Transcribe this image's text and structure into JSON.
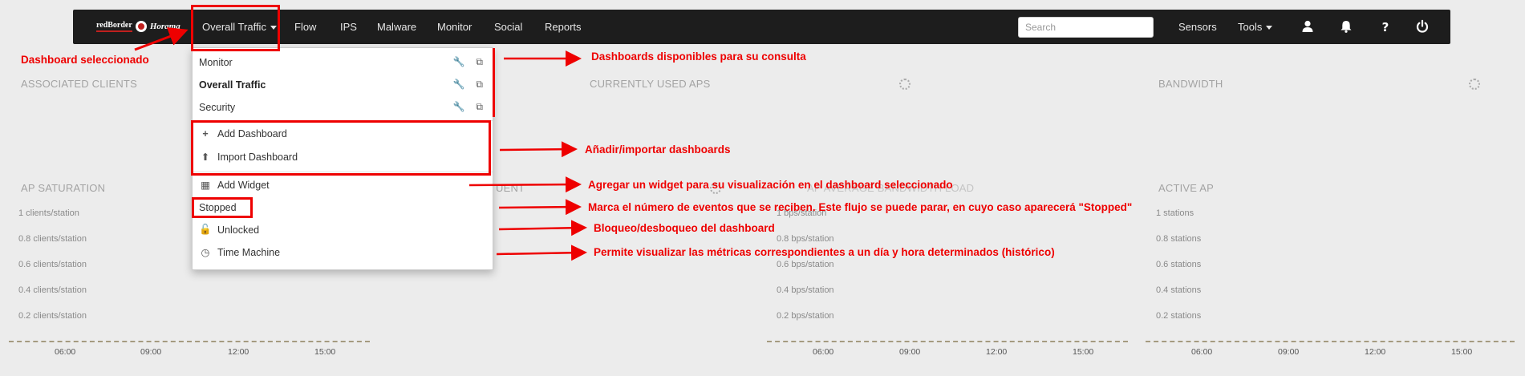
{
  "navbar": {
    "brand_left": "redBorder",
    "brand_right": "Horama",
    "selected_dashboard": "Overall Traffic",
    "menu": [
      "Flow",
      "IPS",
      "Malware",
      "Monitor",
      "Social",
      "Reports"
    ],
    "search_placeholder": "Search",
    "sensors": "Sensors",
    "tools": "Tools",
    "icons": [
      "user-icon",
      "bell-icon",
      "help-icon",
      "power-icon"
    ]
  },
  "dropdown": {
    "dashboards": [
      {
        "label": "Monitor",
        "active": false
      },
      {
        "label": "Overall Traffic",
        "active": true
      },
      {
        "label": "Security",
        "active": false
      }
    ],
    "add_dashboard": "Add Dashboard",
    "import_dashboard": "Import Dashboard",
    "add_widget": "Add Widget",
    "stopped": "Stopped",
    "unlocked": "Unlocked",
    "time_machine": "Time Machine"
  },
  "annotations": {
    "selected": "Dashboard seleccionado",
    "available": "Dashboards disponibles para su consulta",
    "add_import": "Añadir/importar dashboards",
    "add_widget": "Agregar un widget para su visualización en el dashboard seleccionado",
    "events": "Marca el número de eventos que se reciben. Este flujo se puede parar, en cuyo caso aparecerá \"Stopped\"",
    "lock": "Bloqueo/desboqueo del dashboard",
    "time_machine": "Permite visualizar las métricas correspondientes a un día y hora determinados (histórico)"
  },
  "widgets": {
    "associated_clients": "ASSOCIATED CLIENTS",
    "currently_used_aps": "CURRENTLY USED APS",
    "bandwidth": "BANDWIDTH",
    "ap_saturation": "AP SATURATION",
    "frag_client": "UENT",
    "frag_avg_bw": "AP AVERAGE BANDWIDTH LOAD",
    "active_ap": "ACTIVE AP"
  },
  "charts": {
    "saturation": {
      "ylabels": [
        "1 clients/station",
        "0.8 clients/station",
        "0.6 clients/station",
        "0.4 clients/station",
        "0.2 clients/station"
      ],
      "xlabels": [
        "06:00",
        "09:00",
        "12:00",
        "15:00"
      ]
    },
    "bandwidth_load": {
      "ylabels": [
        "1 bps/station",
        "0.8 bps/station",
        "0.6 bps/station",
        "0.4 bps/station",
        "0.2 bps/station"
      ],
      "xlabels": [
        "06:00",
        "09:00",
        "12:00",
        "15:00"
      ]
    },
    "active_ap": {
      "ylabels": [
        "1 stations",
        "0.8 stations",
        "0.6 stations",
        "0.4 stations",
        "0.2 stations"
      ],
      "xlabels": [
        "06:00",
        "09:00",
        "12:00",
        "15:00"
      ]
    }
  }
}
